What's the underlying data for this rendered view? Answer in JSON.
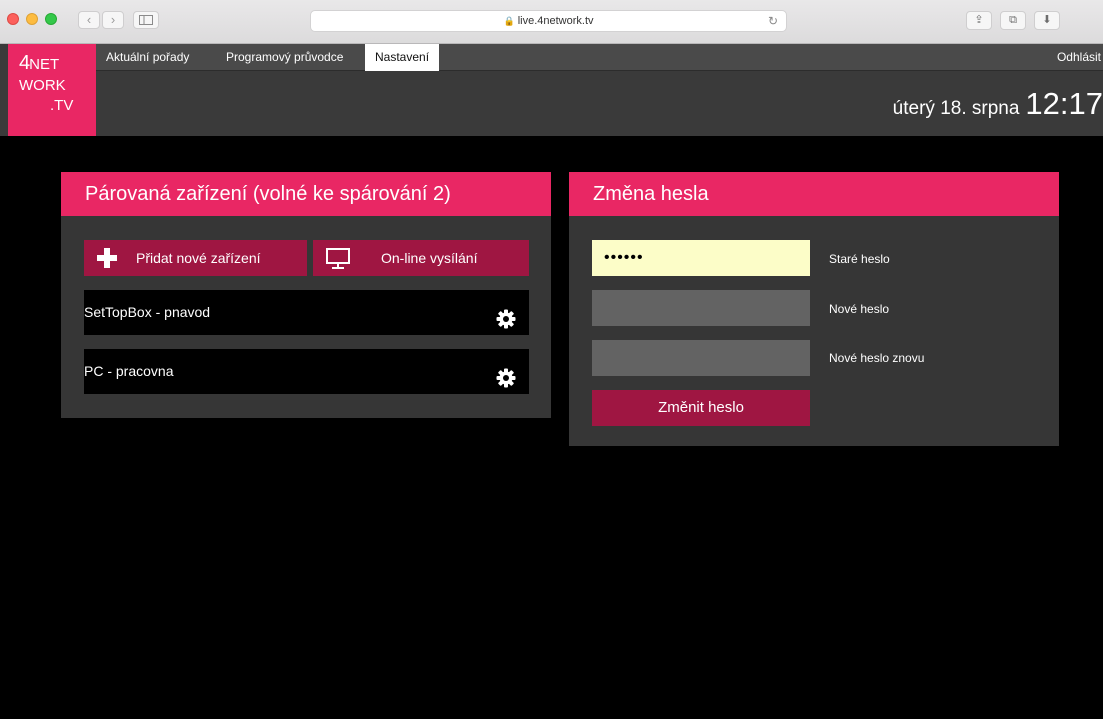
{
  "browser": {
    "url": "live.4network.tv",
    "icons": [
      "close-icon",
      "minimize-icon",
      "zoom-icon",
      "back-icon",
      "forward-icon",
      "sidebar-icon",
      "lock-icon",
      "reload-icon",
      "share-icon",
      "tabs-icon",
      "downloads-icon"
    ]
  },
  "logo": {
    "line1_big": "4",
    "line1_small": "NET",
    "line2": "WORK",
    "line3": ".TV"
  },
  "nav": {
    "items": [
      {
        "label": "Aktuální pořady",
        "active": false
      },
      {
        "label": "Programový průvodce",
        "active": false
      },
      {
        "label": "Nastavení",
        "active": true
      }
    ],
    "logout": "Odhlásit"
  },
  "datetime": {
    "date": "úterý 18. srpna",
    "time": "12:17"
  },
  "devices_panel": {
    "title": "Párovaná zařízení (volné ke spárování 2)",
    "add_button": "Přidat nové zařízení",
    "live_button": "On-line vysílání",
    "devices": [
      {
        "name": "SetTopBox - pnavod",
        "icon": "gear-icon"
      },
      {
        "name": "PC - pracovna",
        "icon": "gear-icon"
      }
    ]
  },
  "password_panel": {
    "title": "Změna hesla",
    "old_password_value": "••••••",
    "old_password_label": "Staré heslo",
    "new_password_label": "Nové heslo",
    "new_password_again_label": "Nové heslo znovu",
    "submit_button": "Změnit heslo"
  },
  "colors": {
    "accent_pink": "#e92764",
    "button_crimson": "#9f1642",
    "panel_bg": "#363636",
    "header_bg": "#3a3a3a",
    "autofill_yellow": "#fcfdc8"
  }
}
